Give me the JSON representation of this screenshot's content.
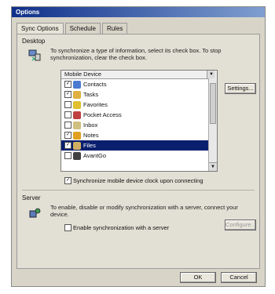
{
  "window": {
    "title": "Options"
  },
  "tabs": [
    {
      "label": "Sync Options"
    },
    {
      "label": "Schedule"
    },
    {
      "label": "Rules"
    }
  ],
  "desktop": {
    "section_label": "Desktop",
    "description": "To synchronize a type of information, select its check box. To stop synchronization, clear the check box.",
    "list_header": "Mobile Device",
    "items": [
      {
        "label": "Contacts",
        "checked": true,
        "icon": "contacts-icon",
        "color": "#4a7bd0"
      },
      {
        "label": "Tasks",
        "checked": true,
        "icon": "tasks-icon",
        "color": "#e0b040"
      },
      {
        "label": "Favorites",
        "checked": false,
        "icon": "favorites-icon",
        "color": "#e0c030"
      },
      {
        "label": "Pocket Access",
        "checked": false,
        "icon": "pocket-access-icon",
        "color": "#c04040"
      },
      {
        "label": "Inbox",
        "checked": false,
        "icon": "inbox-icon",
        "color": "#d0c080"
      },
      {
        "label": "Notes",
        "checked": true,
        "icon": "notes-icon",
        "color": "#e0a020"
      },
      {
        "label": "Files",
        "checked": true,
        "icon": "files-icon",
        "color": "#d0b060",
        "selected": true
      },
      {
        "label": "AvantGo",
        "checked": false,
        "icon": "avantgo-icon",
        "color": "#404040"
      }
    ],
    "settings_button": "Settings...",
    "sync_on_connect": "Synchronize mobile device clock upon connecting"
  },
  "server": {
    "section_label": "Server",
    "description": "To enable, disable or modify synchronization with a server, connect your device.",
    "enable_label": "Enable synchronization with a server",
    "configure_button": "Configure..."
  },
  "footer": {
    "ok_button": "OK",
    "cancel_button": "Cancel"
  }
}
